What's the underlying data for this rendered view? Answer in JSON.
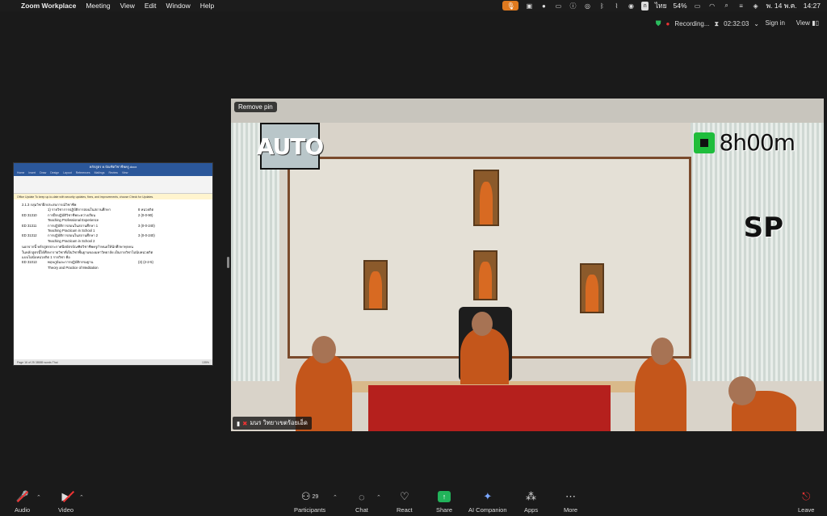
{
  "menubar": {
    "apple": "",
    "items": [
      "Zoom Workplace",
      "Meeting",
      "View",
      "Edit",
      "Window",
      "Help"
    ],
    "battery": "54%",
    "input_source": "ไทย",
    "input_badge": "ก",
    "date": "พ. 14 พ.ค.",
    "time": "14:27"
  },
  "topbar": {
    "recording": "Recording...",
    "duration": "02:32:03",
    "sign_in": "Sign in",
    "view": "View"
  },
  "shared_doc": {
    "title": "หลักสูตร ค.บัณฑิตวิชาชีพครู.docx",
    "tabs": [
      "Home",
      "Insert",
      "Draw",
      "Design",
      "Layout",
      "References",
      "Mailings",
      "Review",
      "View"
    ],
    "update_text": "Office Update  To keep up-to-date with security updates, fixes, and improvements, choose Check for Updates.",
    "heading": "2.1.3 กลุ่มวิชาฝึกประสบการณ์วิชาชีพ",
    "subheading": "1) รายวิชาการปฏิบัติการสอนในสถานศึกษา",
    "credit_header": "8 หน่วยกิต",
    "rows": [
      {
        "code": "ED 31310",
        "name": "การฝึกปฏิบัติวิชาชีพระหว่างเรียน",
        "credit": "2 (0-0-90)"
      },
      {
        "code": "",
        "name": "Teaching Professional Experience",
        "credit": ""
      },
      {
        "code": "ED 31311",
        "name": "การปฏิบัติการสอนในสถานศึกษา 1",
        "credit": "3 (0-0-240)"
      },
      {
        "code": "",
        "name": "Teaching Practicum in School 1",
        "credit": ""
      },
      {
        "code": "ED 31312",
        "name": "การปฏิบัติการสอนในสถานศึกษา 2",
        "credit": "3 (0-0-240)"
      },
      {
        "code": "",
        "name": "Teaching Practicum in School 2",
        "credit": ""
      }
    ],
    "para1": "นอกจากนี้ หลักสูตรประกาศนียบัตรบัณฑิตวิชาชีพครูกำหนดให้นักศึกษาทุกคน",
    "para2": "ในหลักสูตรนี้ได้ศึกษารายวิชาที่เป็นวิชาพื้นฐานของมหาวิทยาลัย เป็นรายวิชาไม่นับหน่วยกิต",
    "para3": "แบบไม่นับหน่วยกิต 1 รายวิชา คือ",
    "extra_code": "ED 31013",
    "extra_name": "พฤษภูมิและการปฏิบัติกรรมฐาน",
    "extra_credit": "(3) (2-2-5)",
    "extra_en": "Theory and Practice of Meditation",
    "status": "Page 16 of 25   38585 words   Thai",
    "zoom": "135%"
  },
  "video": {
    "remove_pin": "Remove pin",
    "auto_label": "AUTO",
    "timer_label": "8h00m",
    "sp_label": "SP",
    "participant_name": "มนร วิทยาเขตร้อยเอ็ด"
  },
  "toolbar": {
    "audio": "Audio",
    "video": "Video",
    "participants": "Participants",
    "participants_count": "29",
    "chat": "Chat",
    "react": "React",
    "share": "Share",
    "ai": "AI Companion",
    "apps": "Apps",
    "more": "More",
    "leave": "Leave"
  }
}
